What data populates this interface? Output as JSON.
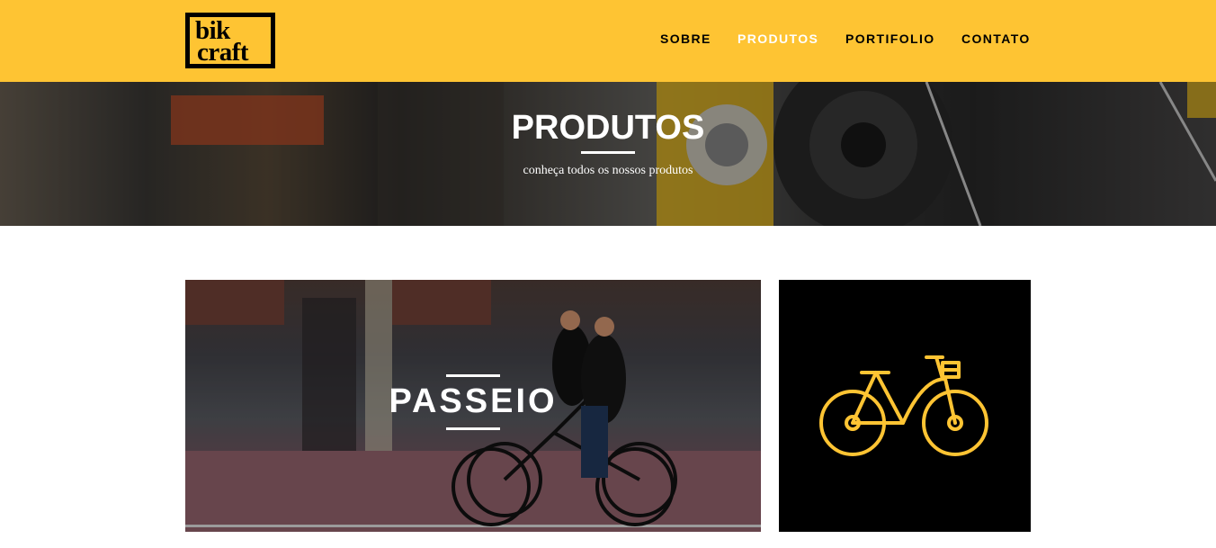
{
  "header": {
    "logo": {
      "line1": "bik",
      "line2": "craft"
    },
    "nav": [
      {
        "label": "SOBRE",
        "active": false
      },
      {
        "label": "PRODUTOS",
        "active": true
      },
      {
        "label": "PORTIFOLIO",
        "active": false
      },
      {
        "label": "CONTATO",
        "active": false
      }
    ]
  },
  "hero": {
    "title": "PRODUTOS",
    "subtitle": "conheça todos os nossos produtos"
  },
  "cards": {
    "passeio": {
      "title": "PASSEIO"
    },
    "icon": {
      "icon": "bicycle-icon",
      "color": "#fec433"
    }
  },
  "colors": {
    "brand_yellow": "#fec433",
    "text_dark": "#000000",
    "active_nav": "#ffffff"
  }
}
